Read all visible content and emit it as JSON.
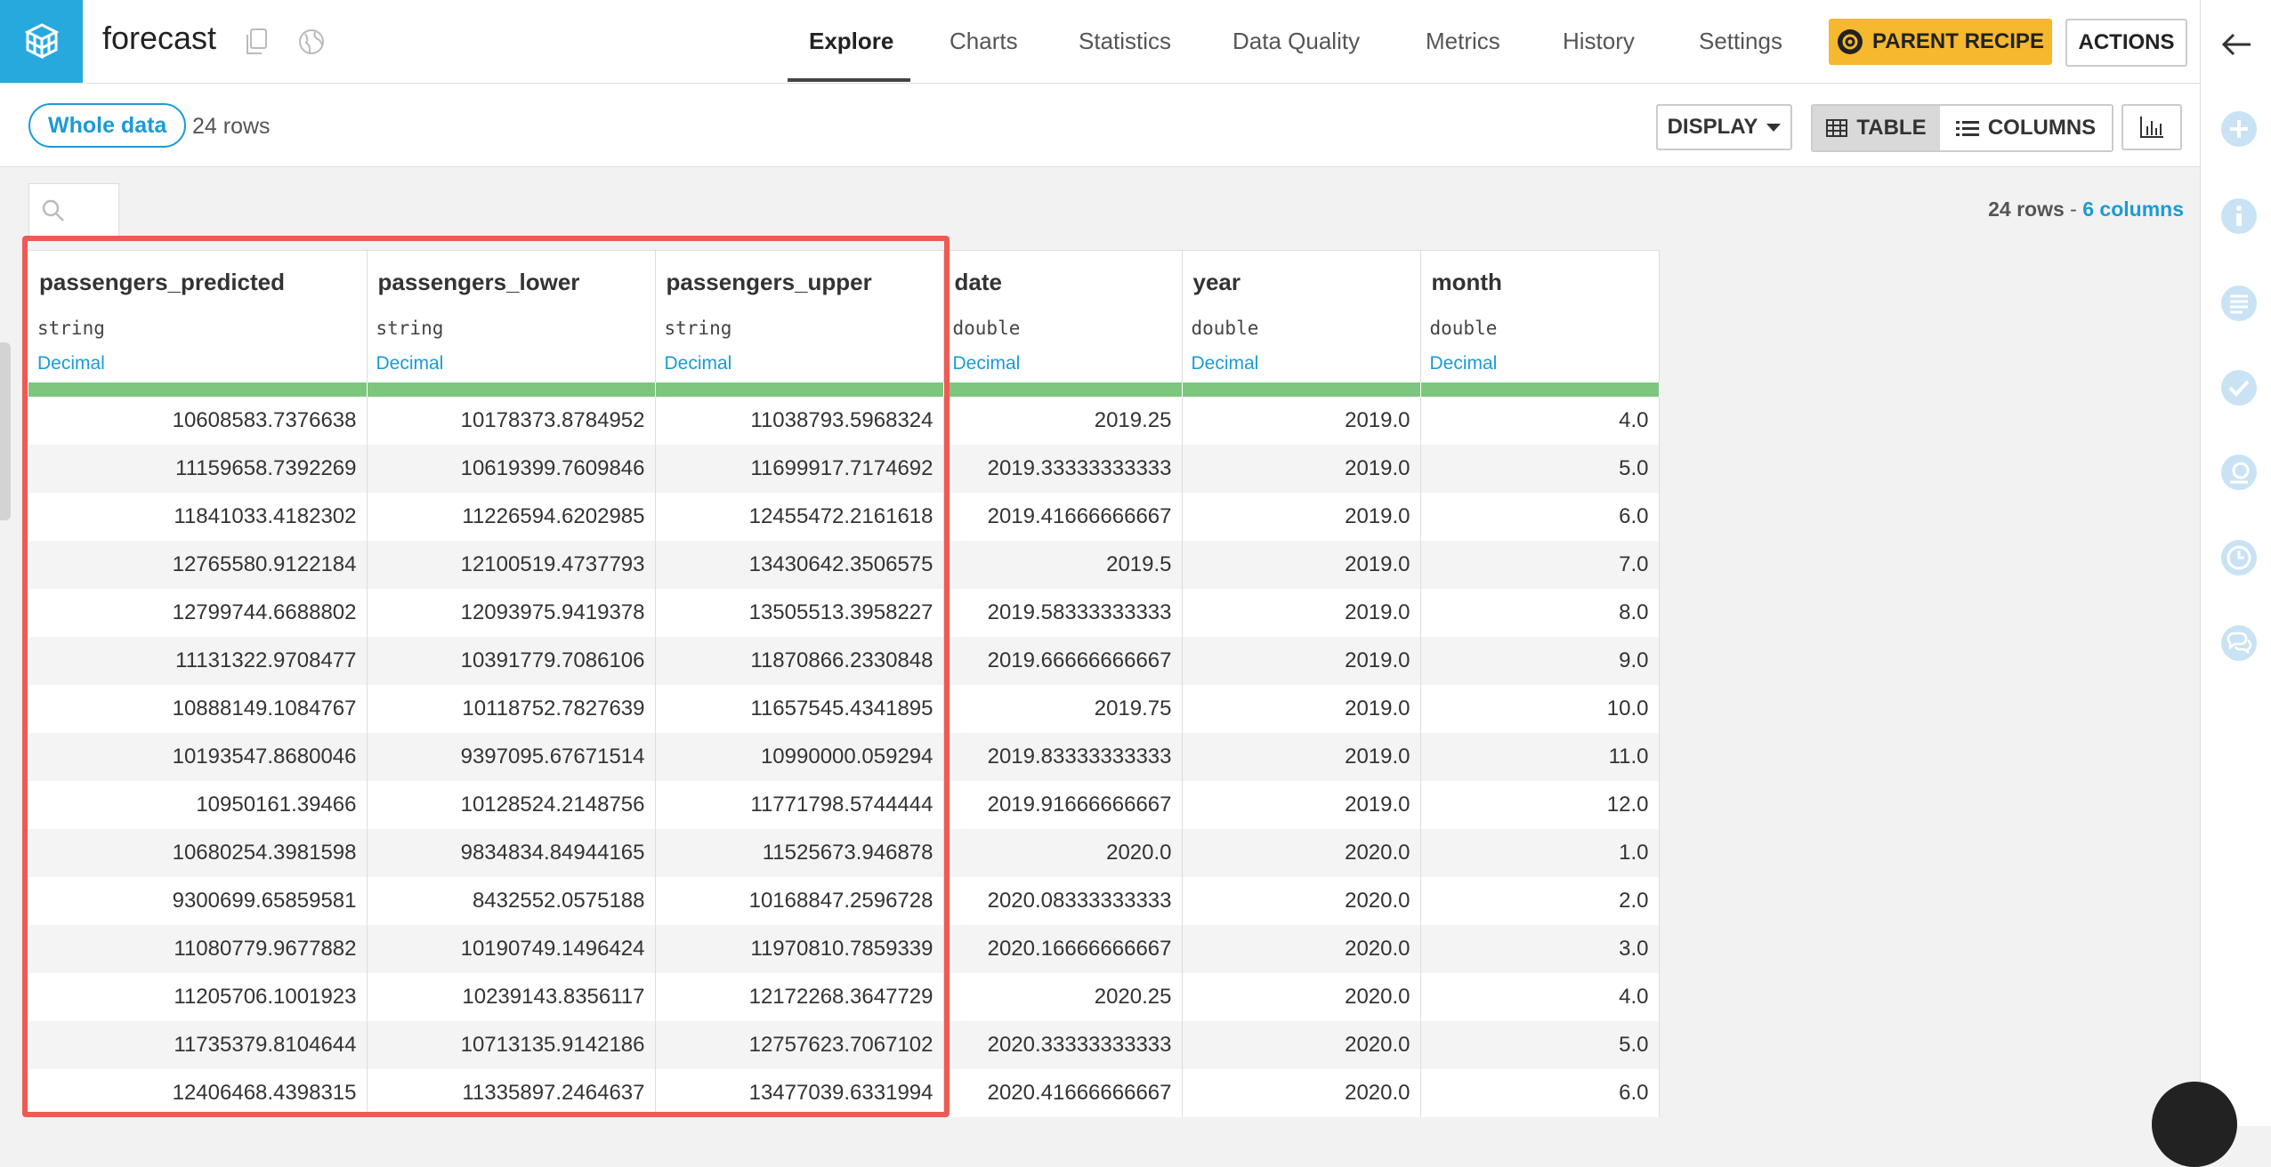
{
  "header": {
    "dataset_name": "forecast",
    "tabs": [
      {
        "label": "Explore",
        "active": true
      },
      {
        "label": "Charts"
      },
      {
        "label": "Statistics"
      },
      {
        "label": "Data Quality"
      },
      {
        "label": "Metrics"
      },
      {
        "label": "History"
      },
      {
        "label": "Settings"
      }
    ],
    "parent_recipe_label": "PARENT RECIPE",
    "actions_label": "ACTIONS"
  },
  "subbar": {
    "sample_label": "Whole data",
    "rows_label": "24 rows",
    "display_label": "DISPLAY",
    "table_label": "TABLE",
    "columns_label": "COLUMNS"
  },
  "summary": {
    "rows": "24 rows",
    "sep": " - ",
    "columns": "6 columns"
  },
  "columns": [
    {
      "name": "passengers_predicted",
      "type": "string",
      "meaning": "Decimal"
    },
    {
      "name": "passengers_lower",
      "type": "string",
      "meaning": "Decimal"
    },
    {
      "name": "passengers_upper",
      "type": "string",
      "meaning": "Decimal"
    },
    {
      "name": "date",
      "type": "double",
      "meaning": "Decimal"
    },
    {
      "name": "year",
      "type": "double",
      "meaning": "Decimal"
    },
    {
      "name": "month",
      "type": "double",
      "meaning": "Decimal"
    }
  ],
  "rows": [
    [
      "10608583.7376638",
      "10178373.8784952",
      "11038793.5968324",
      "2019.25",
      "2019.0",
      "4.0"
    ],
    [
      "11159658.7392269",
      "10619399.7609846",
      "11699917.7174692",
      "2019.33333333333",
      "2019.0",
      "5.0"
    ],
    [
      "11841033.4182302",
      "11226594.6202985",
      "12455472.2161618",
      "2019.41666666667",
      "2019.0",
      "6.0"
    ],
    [
      "12765580.9122184",
      "12100519.4737793",
      "13430642.3506575",
      "2019.5",
      "2019.0",
      "7.0"
    ],
    [
      "12799744.6688802",
      "12093975.9419378",
      "13505513.3958227",
      "2019.58333333333",
      "2019.0",
      "8.0"
    ],
    [
      "11131322.9708477",
      "10391779.7086106",
      "11870866.2330848",
      "2019.66666666667",
      "2019.0",
      "9.0"
    ],
    [
      "10888149.1084767",
      "10118752.7827639",
      "11657545.4341895",
      "2019.75",
      "2019.0",
      "10.0"
    ],
    [
      "10193547.8680046",
      "9397095.67671514",
      "10990000.059294",
      "2019.83333333333",
      "2019.0",
      "11.0"
    ],
    [
      "10950161.39466",
      "10128524.2148756",
      "11771798.5744444",
      "2019.91666666667",
      "2019.0",
      "12.0"
    ],
    [
      "10680254.3981598",
      "9834834.84944165",
      "11525673.946878",
      "2020.0",
      "2020.0",
      "1.0"
    ],
    [
      "9300699.65859581",
      "8432552.0575188",
      "10168847.2596728",
      "2020.08333333333",
      "2020.0",
      "2.0"
    ],
    [
      "11080779.9677882",
      "10190749.1496424",
      "11970810.7859339",
      "2020.16666666667",
      "2020.0",
      "3.0"
    ],
    [
      "11205706.1001923",
      "10239143.8356117",
      "12172268.3647729",
      "2020.25",
      "2020.0",
      "4.0"
    ],
    [
      "11735379.8104644",
      "10713135.9142186",
      "12757623.7067102",
      "2020.33333333333",
      "2020.0",
      "5.0"
    ],
    [
      "12406468.4398315",
      "11335897.2464637",
      "13477039.6331994",
      "2020.41666666667",
      "2020.0",
      "6.0"
    ]
  ],
  "colors": {
    "accent": "#1a9bd6",
    "logo_bg": "#28a9dd",
    "parent_recipe_bg": "#f5b82e",
    "quality_bar": "#7dc67d",
    "highlight_border": "#ee5a55"
  }
}
